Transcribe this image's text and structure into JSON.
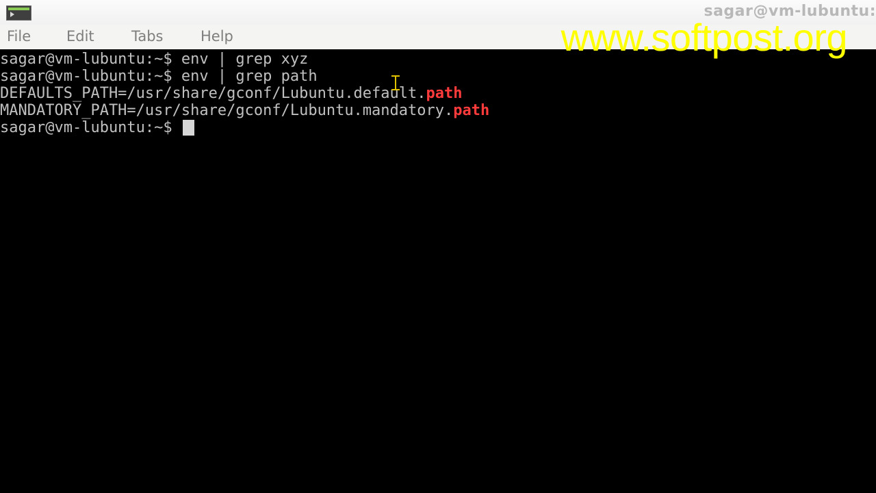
{
  "window": {
    "title": "sagar@vm-lubuntu:",
    "icon": "terminal-app-icon"
  },
  "menu": {
    "file": "File",
    "edit": "Edit",
    "tabs": "Tabs",
    "help": "Help"
  },
  "terminal": {
    "line1": "sagar@vm-lubuntu:~$ env | grep xyz",
    "line2": "sagar@vm-lubuntu:~$ env | grep path",
    "line3_prefix": "DEFAULTS_PATH=/usr/share/gconf/Lubuntu.default.",
    "line3_match": "path",
    "line4_prefix": "MANDATORY_PATH=/usr/share/gconf/Lubuntu.mandatory.",
    "line4_match": "path",
    "prompt": "sagar@vm-lubuntu:~$ "
  },
  "watermark": "www.softpost.org",
  "colors": {
    "terminal_bg": "#000000",
    "terminal_fg": "#c0c0c0",
    "grep_match": "#ff3b3b",
    "watermark": "#ffff00",
    "menubar_bg": "#f4f4f2",
    "menu_text": "#7e7e7e"
  }
}
